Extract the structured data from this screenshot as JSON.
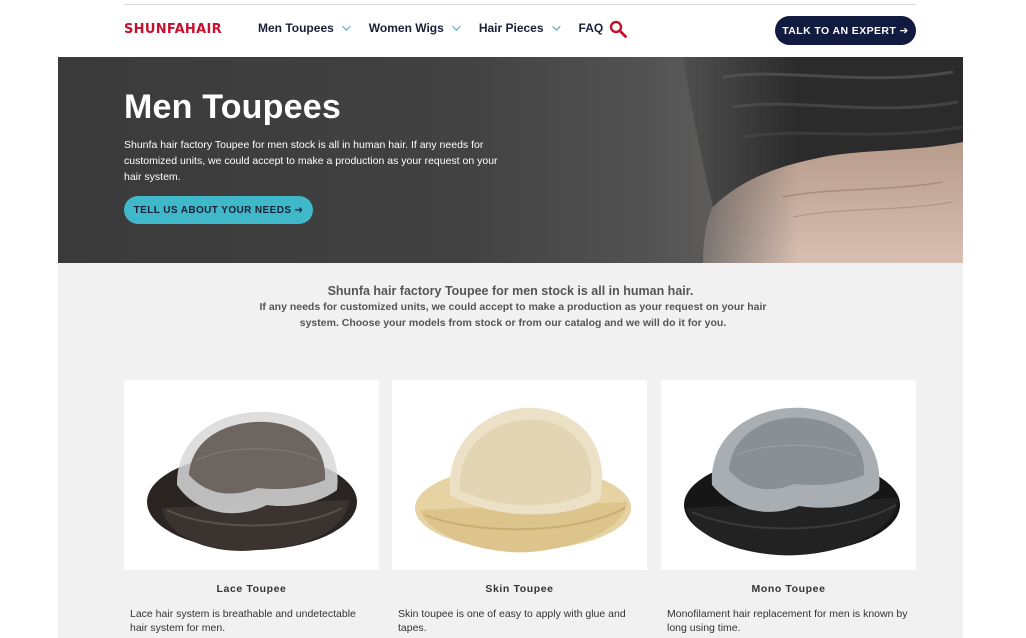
{
  "header": {
    "logo": "SHUNFAHAIR",
    "nav": [
      {
        "label": "Men Toupees",
        "has_dropdown": true
      },
      {
        "label": "Women Wigs",
        "has_dropdown": true
      },
      {
        "label": "Hair Pieces",
        "has_dropdown": true
      },
      {
        "label": "FAQ",
        "has_dropdown": false
      }
    ],
    "search_icon": "search-icon",
    "cta_label": "TALK TO AN EXPERT ➔"
  },
  "hero": {
    "title": "Men Toupees",
    "description": "Shunfa hair factory Toupee for men stock is all in human hair. If any needs for customized units, we could accept to make a production as your request on your hair system.",
    "button_label": "TELL US ABOUT YOUR NEEDS ➔"
  },
  "intro": {
    "heading": "Shunfa hair factory Toupee for men stock is all in human hair.",
    "body": "If any needs for customized units, we could accept to make a production as your request on your hair system. Choose your models from stock or from our catalog and we will do it for you."
  },
  "products": [
    {
      "title": "Lace Toupee",
      "description": "Lace hair system is breathable and undetectable hair system for men."
    },
    {
      "title": "Skin Toupee",
      "description": "Skin toupee is one of easy to apply with glue and tapes."
    },
    {
      "title": "Mono Toupee",
      "description": "Monofilament hair replacement for men is known by long using time."
    }
  ],
  "colors": {
    "brand_red": "#c8102e",
    "navy": "#111a3f",
    "teal": "#3fb8c9"
  }
}
